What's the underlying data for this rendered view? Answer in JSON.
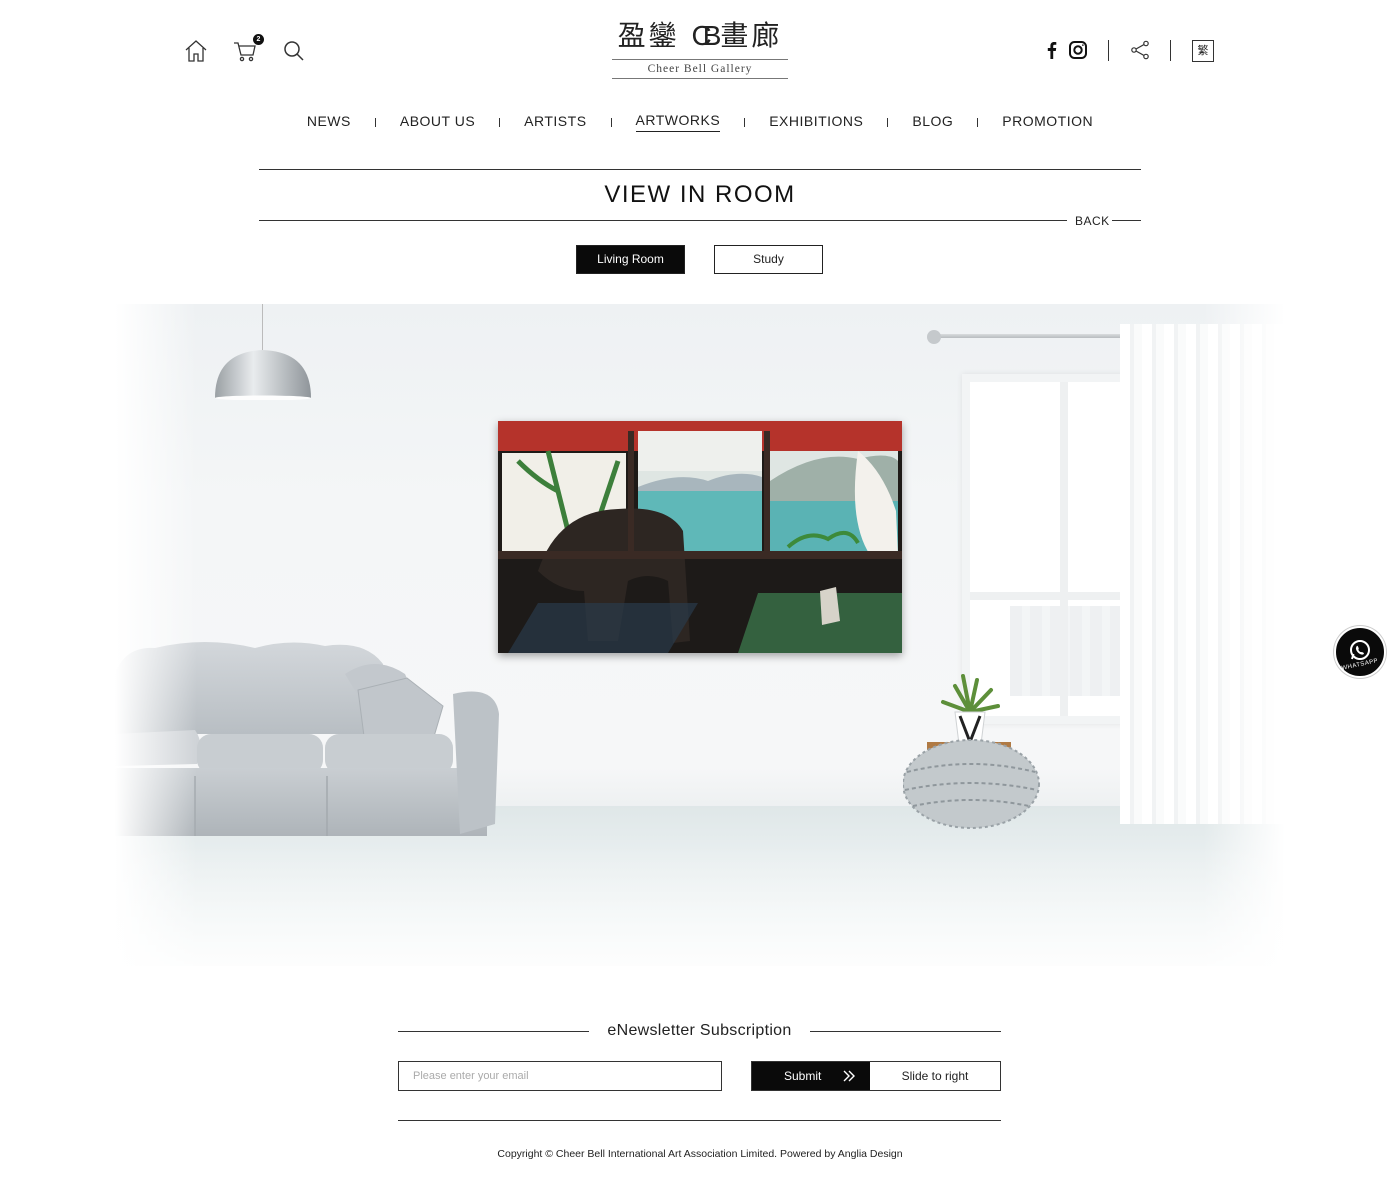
{
  "header": {
    "cart_count": "2",
    "logo_cn_1": "盈鑾",
    "logo_cb": "CB",
    "logo_cn_2": "畫廊",
    "logo_en": "Cheer Bell Gallery",
    "lang_label": "繁"
  },
  "nav": {
    "items": [
      "NEWS",
      "ABOUT US",
      "ARTISTS",
      "ARTWORKS",
      "EXHIBITIONS",
      "BLOG",
      "PROMOTION"
    ],
    "active": "ARTWORKS"
  },
  "page": {
    "title": "VIEW IN ROOM",
    "back_label": "BACK"
  },
  "room_tabs": {
    "living": "Living Room",
    "study": "Study",
    "selected": "Living Room"
  },
  "whatsapp": {
    "label": "WHATSAPP"
  },
  "newsletter": {
    "title": "eNewsletter Subscription",
    "email_placeholder": "Please enter your email",
    "email_value": "",
    "submit_label": "Submit",
    "slide_hint": "Slide to right"
  },
  "footer": {
    "copyright": "Copyright © Cheer Bell International Art Association Limited. Powered by Anglia Design"
  },
  "colors": {
    "primary": "#0a0a0a",
    "background": "#ffffff",
    "text": "#222222"
  },
  "icons": [
    "home-icon",
    "cart-icon",
    "search-icon",
    "facebook-icon",
    "instagram-icon",
    "share-icon",
    "whatsapp-icon",
    "double-chevron-right-icon"
  ]
}
